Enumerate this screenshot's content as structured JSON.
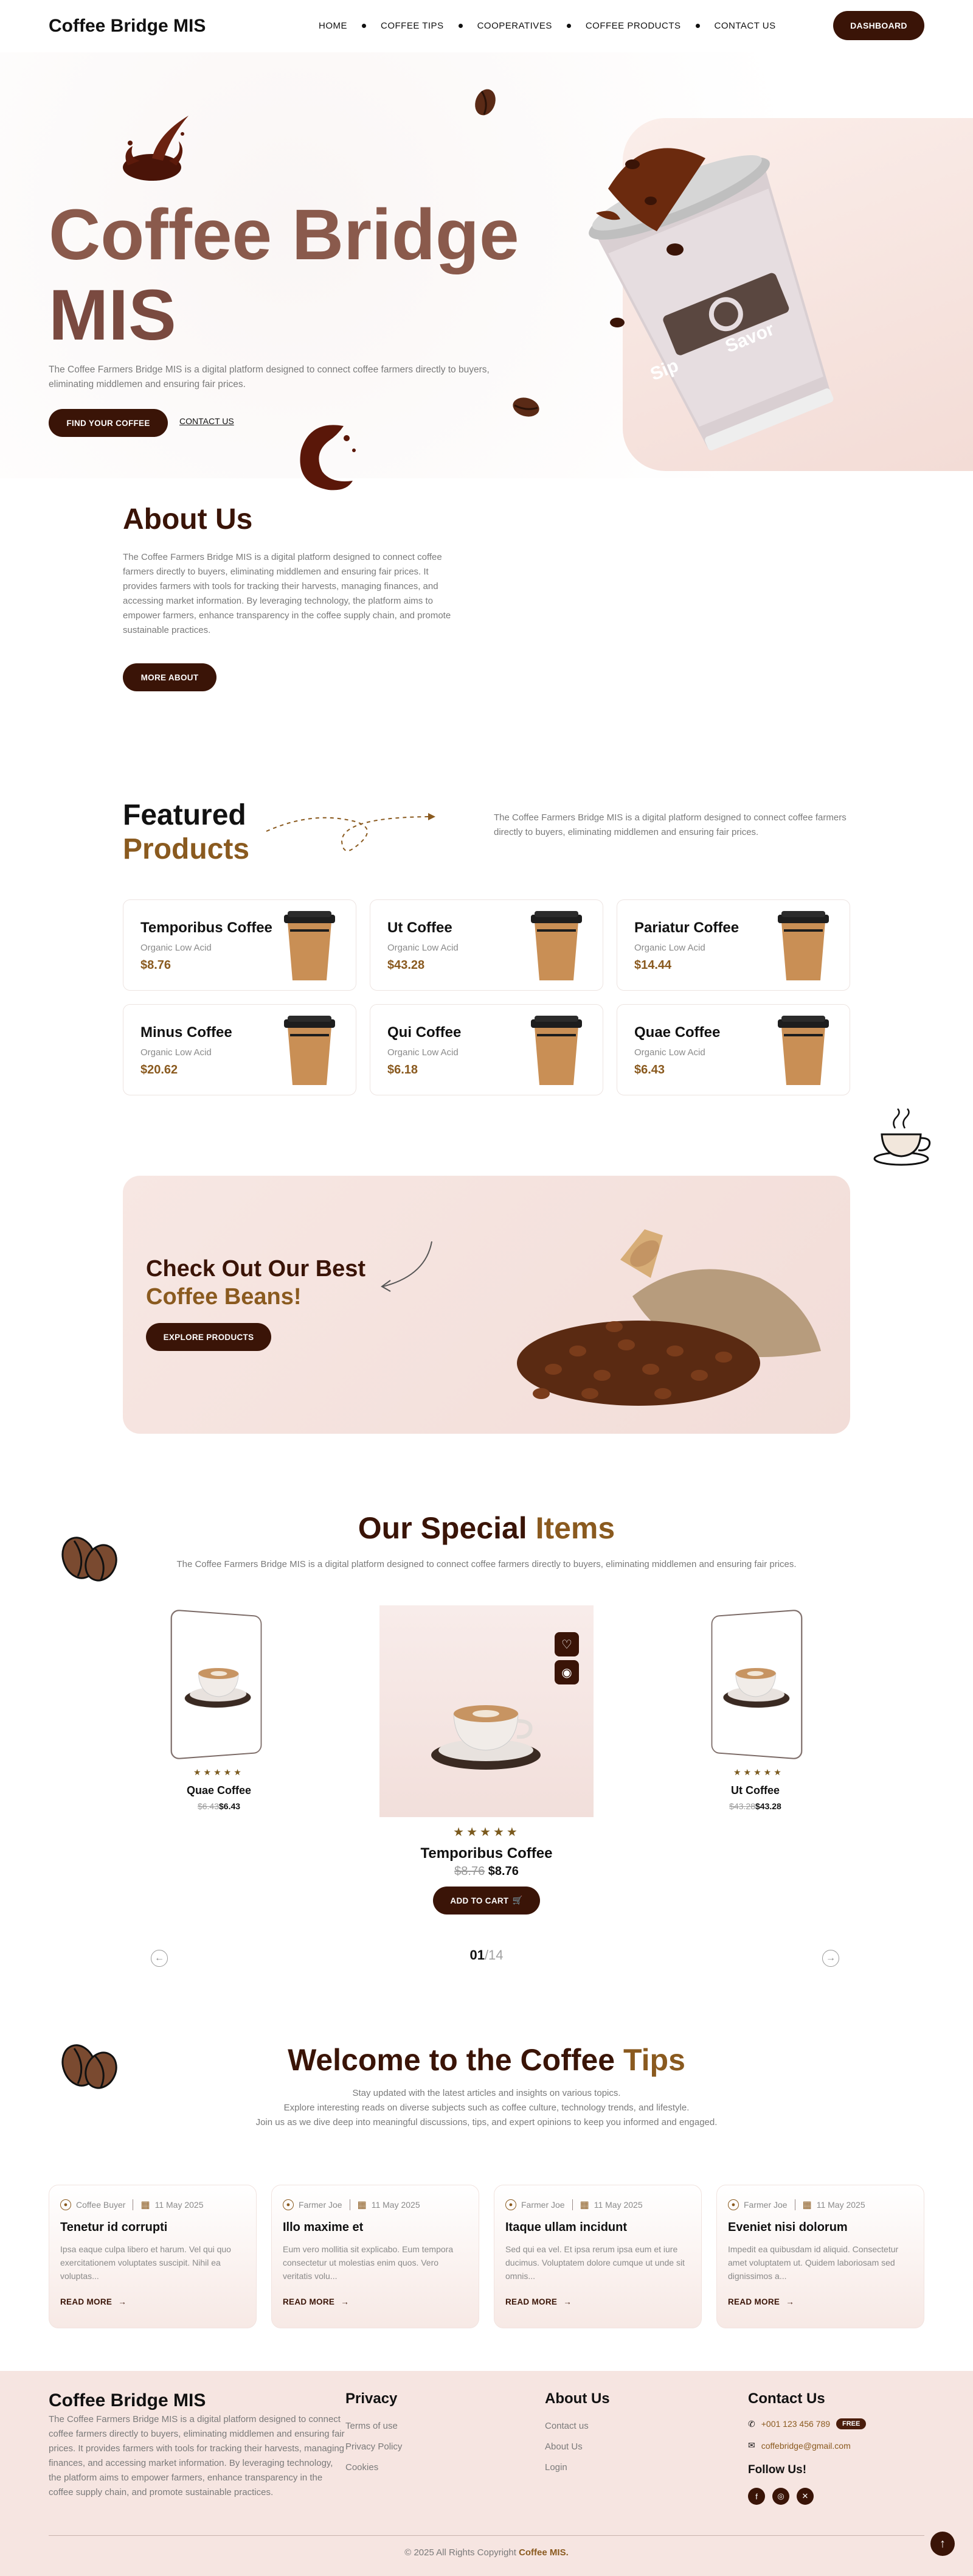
{
  "nav": {
    "logo": "Coffee Bridge MIS",
    "items": [
      "HOME",
      "COFFEE TIPS",
      "COOPERATIVES",
      "COFFEE PRODUCTS",
      "CONTACT US"
    ],
    "dashboard": "DASHBOARD"
  },
  "hero": {
    "title_line1": "Coffee Bridge",
    "title_line2": "MIS",
    "description": "The Coffee Farmers Bridge MIS is a digital platform designed to connect coffee farmers directly to buyers, eliminating middlemen and ensuring fair prices.",
    "find_button": "FIND YOUR COFFEE",
    "contact_link": "CONTACT US",
    "cup_label_left": "Sip",
    "cup_label_right": "Savor"
  },
  "about": {
    "title": "About Us",
    "description": "The Coffee Farmers Bridge MIS is a digital platform designed to connect coffee farmers directly to buyers, eliminating middlemen and ensuring fair prices. It provides farmers with tools for tracking their harvests, managing finances, and accessing market information. By leveraging technology, the platform aims to empower farmers, enhance transparency in the coffee supply chain, and promote sustainable practices.",
    "button": "MORE ABOUT"
  },
  "featured": {
    "title_line1": "Featured",
    "title_line2": "Products",
    "description": "The Coffee Farmers Bridge MIS is a digital platform designed to connect coffee farmers directly to buyers, eliminating middlemen and ensuring fair prices.",
    "products": [
      {
        "name": "Temporibus Coffee",
        "sub": "Organic Low Acid",
        "price": "$8.76"
      },
      {
        "name": "Ut Coffee",
        "sub": "Organic Low Acid",
        "price": "$43.28"
      },
      {
        "name": "Pariatur Coffee",
        "sub": "Organic Low Acid",
        "price": "$14.44"
      },
      {
        "name": "Minus Coffee",
        "sub": "Organic Low Acid",
        "price": "$20.62"
      },
      {
        "name": "Qui Coffee",
        "sub": "Organic Low Acid",
        "price": "$6.18"
      },
      {
        "name": "Quae Coffee",
        "sub": "Organic Low Acid",
        "price": "$6.43"
      }
    ]
  },
  "banner": {
    "title_line1": "Check Out Our Best",
    "title_line2": "Coffee Beans!",
    "button": "EXPLORE PRODUCTS"
  },
  "special": {
    "title_main": "Our Special",
    "title_accent": "Items",
    "description": "The Coffee Farmers Bridge MIS is a digital platform designed to connect coffee farmers directly to buyers, eliminating middlemen and ensuring fair prices.",
    "left": {
      "name": "Quae Coffee",
      "old": "$6.43",
      "new": "$6.43",
      "stars": "★★★★★"
    },
    "center": {
      "name": "Temporibus Coffee",
      "old": "$8.76",
      "new": "$8.76",
      "stars": "★★★★★"
    },
    "right": {
      "name": "Ut Coffee",
      "old": "$43.28",
      "new": "$43.28",
      "stars": "★★★★★"
    },
    "add_to_cart": "ADD TO CART",
    "page_current": "01",
    "page_total": "/14"
  },
  "tips": {
    "title_main": "Welcome to the Coffee",
    "title_accent": "Tips",
    "desc_line1": "Stay updated with the latest articles and insights on various topics.",
    "desc_line2": "Explore interesting reads on diverse subjects such as coffee culture, technology trends, and lifestyle.",
    "desc_line3": "Join us as we dive deep into meaningful discussions, tips, and expert opinions to keep you informed and engaged.",
    "read_more": "READ MORE",
    "posts": [
      {
        "author": "Coffee Buyer",
        "date": "11 May 2025",
        "title": "Tenetur id corrupti",
        "excerpt": "Ipsa eaque culpa libero et harum. Vel qui quo exercitationem voluptates suscipit. Nihil ea voluptas..."
      },
      {
        "author": "Farmer Joe",
        "date": "11 May 2025",
        "title": "Illo maxime et",
        "excerpt": "Eum vero mollitia sit explicabo. Eum tempora consectetur ut molestias enim quos. Vero veritatis volu..."
      },
      {
        "author": "Farmer Joe",
        "date": "11 May 2025",
        "title": "Itaque ullam incidunt",
        "excerpt": "Sed qui ea vel. Et ipsa rerum ipsa eum et iure ducimus. Voluptatem dolore cumque ut unde sit omnis..."
      },
      {
        "author": "Farmer Joe",
        "date": "11 May 2025",
        "title": "Eveniet nisi dolorum",
        "excerpt": "Impedit ea quibusdam id aliquid. Consectetur amet voluptatem ut. Quidem laboriosam sed dignissimos a..."
      }
    ]
  },
  "footer": {
    "logo": "Coffee Bridge MIS",
    "description": "The Coffee Farmers Bridge MIS is a digital platform designed to connect coffee farmers directly to buyers, eliminating middlemen and ensuring fair prices. It provides farmers with tools for tracking their harvests, managing finances, and accessing market information. By leveraging technology, the platform aims to empower farmers, enhance transparency in the coffee supply chain, and promote sustainable practices.",
    "privacy_title": "Privacy",
    "privacy_links": [
      "Terms of use",
      "Privacy Policy",
      "Cookies"
    ],
    "about_title": "About Us",
    "about_links": [
      "Contact us",
      "About Us",
      "Login"
    ],
    "contact_title": "Contact Us",
    "phone": "+001 123 456 789",
    "phone_badge": "FREE",
    "email": "coffebridge@gmail.com",
    "follow_title": "Follow Us!",
    "copyright_prefix": "© 2025 All Rights Copyright",
    "copyright_brand": "Coffee MIS."
  }
}
